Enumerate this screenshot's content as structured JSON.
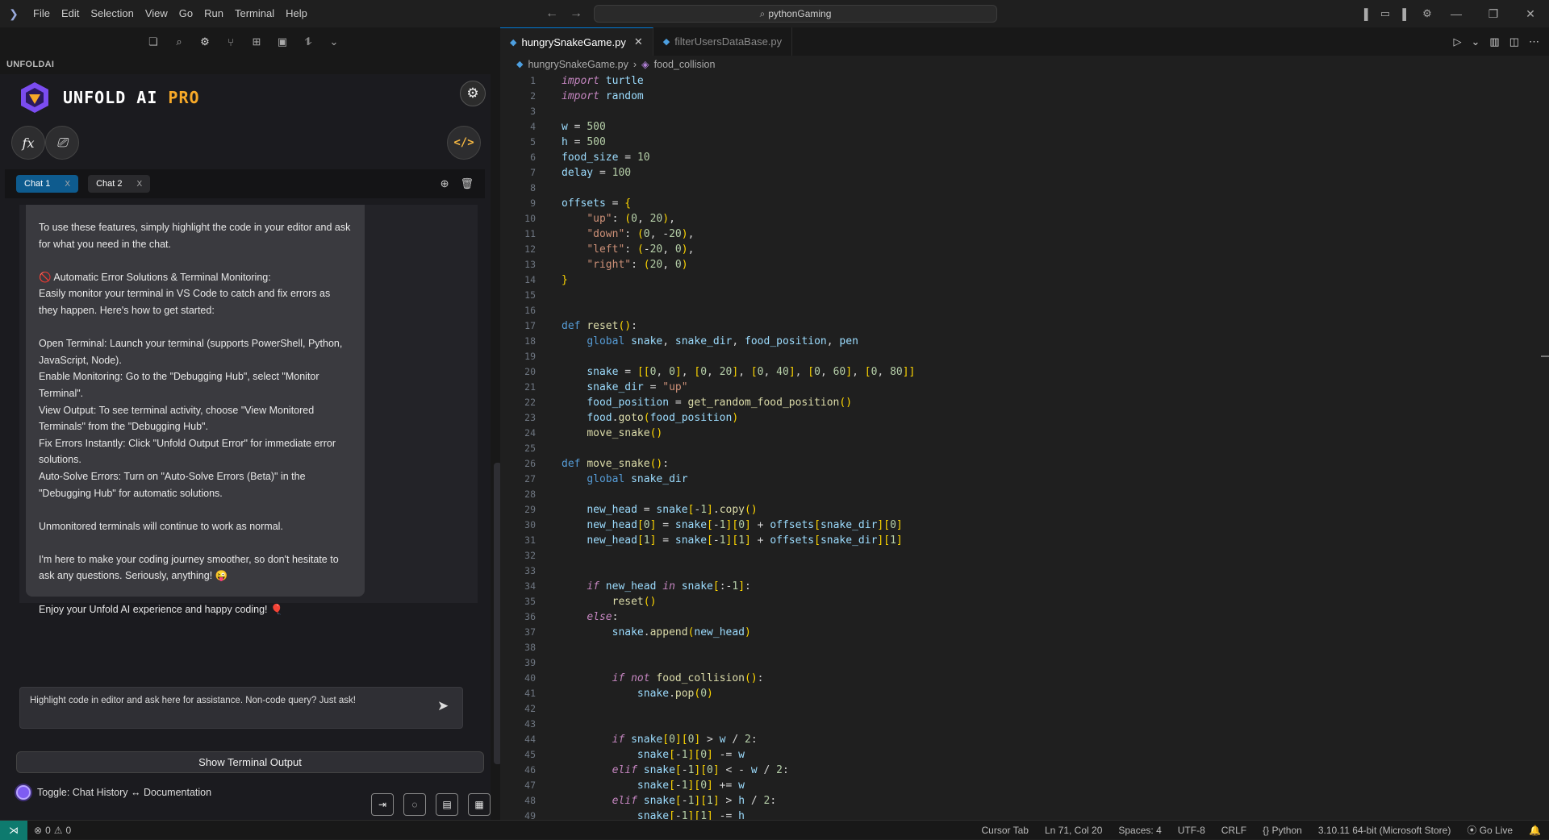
{
  "menu": [
    "File",
    "Edit",
    "Selection",
    "View",
    "Go",
    "Run",
    "Terminal",
    "Help"
  ],
  "search": {
    "label": "pythonGaming"
  },
  "panel": {
    "title": "UNFOLDAI"
  },
  "brand": {
    "name": "UNFOLD AI",
    "tier": "PRO"
  },
  "chat_tabs": [
    {
      "label": "Chat 1",
      "close": "X"
    },
    {
      "label": "Chat 2",
      "close": "X"
    }
  ],
  "chat_message": {
    "p1": "To use these features, simply highlight the code in your editor and ask for what you need in the chat.",
    "p2_title": "Automatic Error Solutions & Terminal Monitoring:",
    "p2_body": "Easily monitor your terminal in VS Code to catch and fix errors as they happen. Here's how to get started:",
    "p3a": "Open Terminal: Launch your terminal (supports PowerShell, Python, JavaScript, Node).",
    "p3b": "Enable Monitoring: Go to the \"Debugging Hub\", select \"Monitor Terminal\".",
    "p3c": "View Output: To see terminal activity, choose \"View Monitored Terminals\" from the \"Debugging Hub\".",
    "p3d": "Fix Errors Instantly: Click \"Unfold Output Error\" for immediate error solutions.",
    "p3e": "Auto-Solve Errors: Turn on \"Auto-Solve Errors (Beta)\" in the \"Debugging Hub\" for automatic solutions.",
    "p4": "Unmonitored terminals will continue to work as normal.",
    "p5": "I'm here to make your coding journey smoother, so don't hesitate to ask any questions. Seriously, anything! 😜",
    "p6": "Enjoy your Unfold AI experience and happy coding! 🎈"
  },
  "input": {
    "placeholder": "Highlight code in editor and ask here for assistance. Non-code query? Just ask!"
  },
  "terminal_button": "Show Terminal Output",
  "toggle_label": "Toggle: Chat History ↔ Documentation",
  "editor_tabs": [
    {
      "label": "hungrySnakeGame.py",
      "active": true
    },
    {
      "label": "filterUsersDataBase.py",
      "active": false
    }
  ],
  "breadcrumb": {
    "file": "hungrySnakeGame.py",
    "symbol": "food_collision"
  },
  "code_lines": [
    "import turtle",
    "import random",
    "",
    "w = 500",
    "h = 500",
    "food_size = 10",
    "delay = 100",
    "",
    "offsets = {",
    "    \"up\": (0, 20),",
    "    \"down\": (0, -20),",
    "    \"left\": (-20, 0),",
    "    \"right\": (20, 0)",
    "}",
    "",
    "",
    "def reset():",
    "    global snake, snake_dir, food_position, pen",
    "",
    "    snake = [[0, 0], [0, 20], [0, 40], [0, 60], [0, 80]]",
    "    snake_dir = \"up\"",
    "    food_position = get_random_food_position()",
    "    food.goto(food_position)",
    "    move_snake()",
    "",
    "def move_snake():",
    "    global snake_dir",
    "",
    "    new_head = snake[-1].copy()",
    "    new_head[0] = snake[-1][0] + offsets[snake_dir][0]",
    "    new_head[1] = snake[-1][1] + offsets[snake_dir][1]",
    "",
    "",
    "    if new_head in snake[:-1]:",
    "        reset()",
    "    else:",
    "        snake.append(new_head)",
    "",
    "",
    "        if not food_collision():",
    "            snake.pop(0)",
    "",
    "",
    "        if snake[0][0] > w / 2:",
    "            snake[-1][0] -= w",
    "        elif snake[-1][0] < - w / 2:",
    "            snake[-1][0] += w",
    "        elif snake[-1][1] > h / 2:",
    "            snake[-1][1] -= h"
  ],
  "status": {
    "errors": "0",
    "warnings": "0",
    "items": [
      "Cursor Tab",
      "Ln 71, Col 20",
      "Spaces: 4",
      "UTF-8",
      "CRLF",
      "Python",
      "3.10.11 64-bit (Microsoft Store)",
      "Go Live"
    ]
  }
}
